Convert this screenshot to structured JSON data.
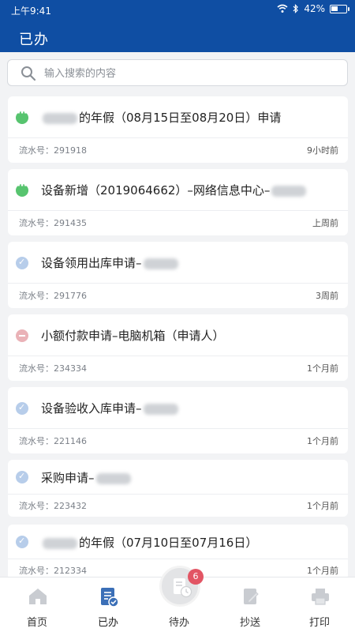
{
  "status_bar": {
    "time": "上午9:41",
    "battery": "42%"
  },
  "header": {
    "title": "已办"
  },
  "search": {
    "placeholder": "输入搜索的内容"
  },
  "list": [
    {
      "status": "in-progress",
      "pre": "",
      "text": "的年假（08月15日至08月20日）申请",
      "blur_before": true,
      "blur_after": false,
      "serial": "流水号：291918",
      "time": "9小时前"
    },
    {
      "status": "in-progress",
      "pre": "",
      "text": "设备新增（2019064662）–网络信息中心–",
      "blur_before": false,
      "blur_after": true,
      "serial": "流水号：291435",
      "time": "上周前"
    },
    {
      "status": "done",
      "pre": "",
      "text": "设备领用出库申请–",
      "blur_before": false,
      "blur_after": true,
      "serial": "流水号：291776",
      "time": "3周前"
    },
    {
      "status": "rejected",
      "pre": "",
      "text": "小额付款申请–电脑机箱（申请人）",
      "blur_before": false,
      "blur_after": false,
      "serial": "流水号：234334",
      "time": "1个月前"
    },
    {
      "status": "done",
      "pre": "",
      "text": "设备验收入库申请–",
      "blur_before": false,
      "blur_after": true,
      "serial": "流水号：221146",
      "time": "1个月前"
    },
    {
      "status": "done",
      "pre": "",
      "text": "采购申请–",
      "blur_before": false,
      "blur_after": true,
      "serial": "流水号：223432",
      "time": "1个月前"
    },
    {
      "status": "done",
      "pre": "",
      "text": "的年假（07月10日至07月16日）",
      "blur_before": true,
      "blur_after": false,
      "serial": "流水号：212334",
      "time": "1个月前"
    }
  ],
  "tabbar": {
    "home": "首页",
    "done": "已办",
    "todo": "待办",
    "todo_badge": "6",
    "cc": "抄送",
    "print": "打印"
  },
  "colors": {
    "primary": "#0f4ea3",
    "green": "#57c46f",
    "blue_done": "#b7cdea",
    "red_rejected": "#eab2b7",
    "badge": "#e25564"
  }
}
